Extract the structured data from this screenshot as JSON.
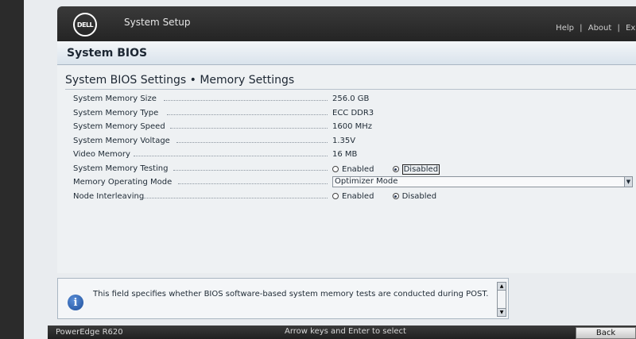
{
  "header": {
    "logo": "DELL",
    "title": "System Setup",
    "links": [
      "Help",
      "About",
      "Exit"
    ]
  },
  "section": {
    "title": "System BIOS"
  },
  "page": {
    "heading": "System BIOS Settings • Memory Settings"
  },
  "settings": {
    "memory_size": {
      "label": "System Memory Size",
      "value": "256.0 GB"
    },
    "memory_type": {
      "label": "System Memory Type",
      "value": "ECC DDR3"
    },
    "memory_speed": {
      "label": "System Memory Speed",
      "value": "1600 MHz"
    },
    "memory_voltage": {
      "label": "System Memory Voltage",
      "value": "1.35V"
    },
    "video_memory": {
      "label": "Video Memory",
      "value": "16 MB"
    },
    "memory_testing": {
      "label": "System Memory Testing",
      "options": [
        "Enabled",
        "Disabled"
      ],
      "selected": "Disabled"
    },
    "operating_mode": {
      "label": "Memory Operating Mode",
      "selected": "Optimizer Mode"
    },
    "node_interleaving": {
      "label": "Node Interleaving",
      "options": [
        "Enabled",
        "Disabled"
      ],
      "selected": "Disabled"
    }
  },
  "help": {
    "text": "This field specifies whether BIOS software-based system memory tests are conducted during POST."
  },
  "footer": {
    "model": "PowerEdge R620",
    "hint": "Arrow keys and Enter to select",
    "back_label": "Back"
  },
  "icons": {
    "info": "info-icon",
    "dropdown": "chevron-down-icon",
    "scroll_up": "chevron-up-icon",
    "scroll_down": "chevron-down-icon"
  }
}
